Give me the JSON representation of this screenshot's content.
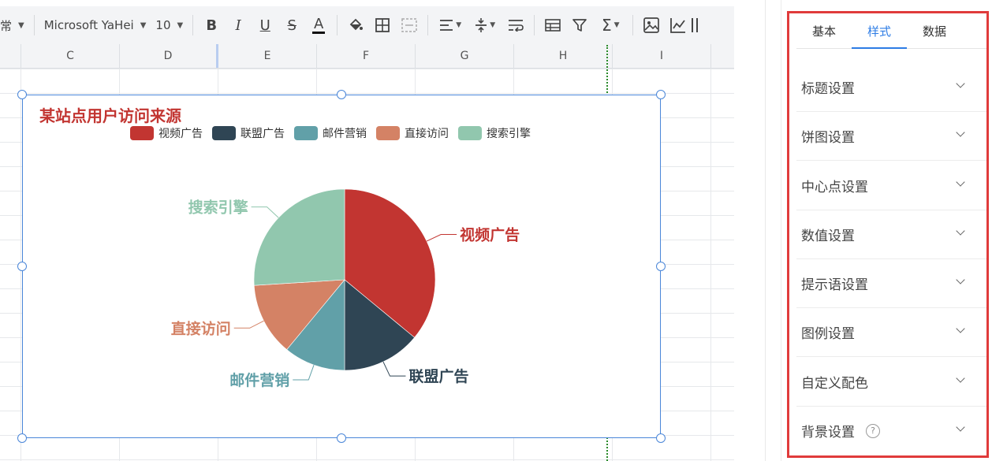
{
  "toolbar": {
    "style_select": "常",
    "font_family": "Microsoft YaHei",
    "font_size": "10",
    "icons": [
      "bold-icon",
      "italic-icon",
      "underline-icon",
      "strikethrough-icon",
      "font-color-icon",
      "fill-color-icon",
      "borders-icon",
      "merge-cells-icon",
      "align-icon",
      "vertical-align-icon",
      "wrap-text-icon",
      "table-format-icon",
      "filter-icon",
      "sum-icon",
      "insert-image-icon",
      "insert-chart-icon"
    ],
    "labels": {
      "bold": "B",
      "italic": "I",
      "underline": "U",
      "strike": "S",
      "font_color": "A",
      "sum": "Σ"
    }
  },
  "sheet": {
    "columns": [
      "C",
      "D",
      "E",
      "F",
      "G",
      "H",
      "I"
    ]
  },
  "chart": {
    "title": "某站点用户访问来源",
    "handle_color": "#4a86d8"
  },
  "chart_data": {
    "type": "pie",
    "title": "某站点用户访问来源",
    "legend_position": "top",
    "series": [
      {
        "name": "视频广告",
        "value": 36,
        "color": "#c23531"
      },
      {
        "name": "联盟广告",
        "value": 14,
        "color": "#2f4554"
      },
      {
        "name": "邮件营销",
        "value": 11,
        "color": "#61a0a8"
      },
      {
        "name": "直接访问",
        "value": 13,
        "color": "#d48265"
      },
      {
        "name": "搜索引擎",
        "value": 26,
        "color": "#91c7ae"
      }
    ]
  },
  "panel": {
    "tabs": [
      "基本",
      "样式",
      "数据"
    ],
    "active_tab": "样式",
    "sections": [
      "标题设置",
      "饼图设置",
      "中心点设置",
      "数值设置",
      "提示语设置",
      "图例设置",
      "自定义配色",
      "背景设置"
    ],
    "help_glyph": "?",
    "outline_color": "#e03b3b",
    "accent": "#2d7ce5"
  }
}
